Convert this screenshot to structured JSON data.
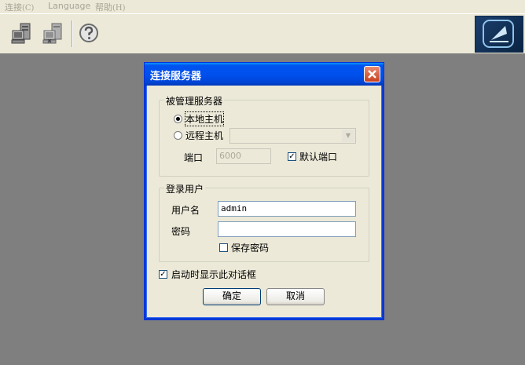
{
  "menu": {
    "connect": "连接",
    "connect_key": "(C)",
    "language": "Language",
    "help": "帮助",
    "help_key": "(H)"
  },
  "toolbar": {
    "buttons": [
      {
        "icon": "connect-server-icon"
      },
      {
        "icon": "disconnect-server-icon"
      },
      {
        "icon": "help-icon"
      }
    ]
  },
  "dialog": {
    "title": "连接服务器",
    "managed_group": {
      "title": "被管理服务器",
      "local_host_label": "本地主机",
      "local_host_selected": true,
      "remote_host_label": "远程主机",
      "remote_host_value": "",
      "port_label": "端口",
      "port_value": "6000",
      "default_port_label": "默认端口",
      "default_port_checked": true
    },
    "login_group": {
      "title": "登录用户",
      "username_label": "用户名",
      "username_value": "admin",
      "password_label": "密码",
      "password_value": "",
      "save_password_label": "保存密码",
      "save_password_checked": false
    },
    "show_on_startup_label": "启动时显示此对话框",
    "show_on_startup_checked": true,
    "ok_label": "确定",
    "cancel_label": "取消"
  }
}
